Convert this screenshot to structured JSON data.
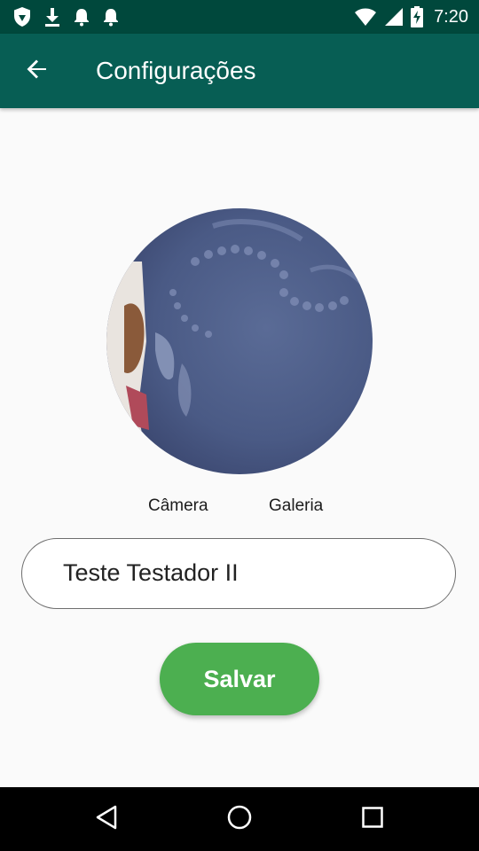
{
  "status_bar": {
    "time": "7:20",
    "left_icons": [
      "shield-icon",
      "download-icon",
      "notification-bell-icon",
      "notification-bell-icon"
    ],
    "right_icons": [
      "wifi-icon",
      "cellular-signal-icon",
      "battery-charging-icon"
    ]
  },
  "app_bar": {
    "title": "Configurações",
    "back_icon": "arrow-back-icon",
    "color": "#075e54"
  },
  "profile": {
    "avatar_icon": "profile-photo"
  },
  "media_actions": {
    "camera_label": "Câmera",
    "gallery_label": "Galeria"
  },
  "name_field": {
    "value": "Teste Testador II"
  },
  "save_button": {
    "label": "Salvar",
    "color": "#4caf50"
  },
  "nav_bar": {
    "icons": [
      "nav-back-icon",
      "nav-home-icon",
      "nav-recents-icon"
    ]
  }
}
